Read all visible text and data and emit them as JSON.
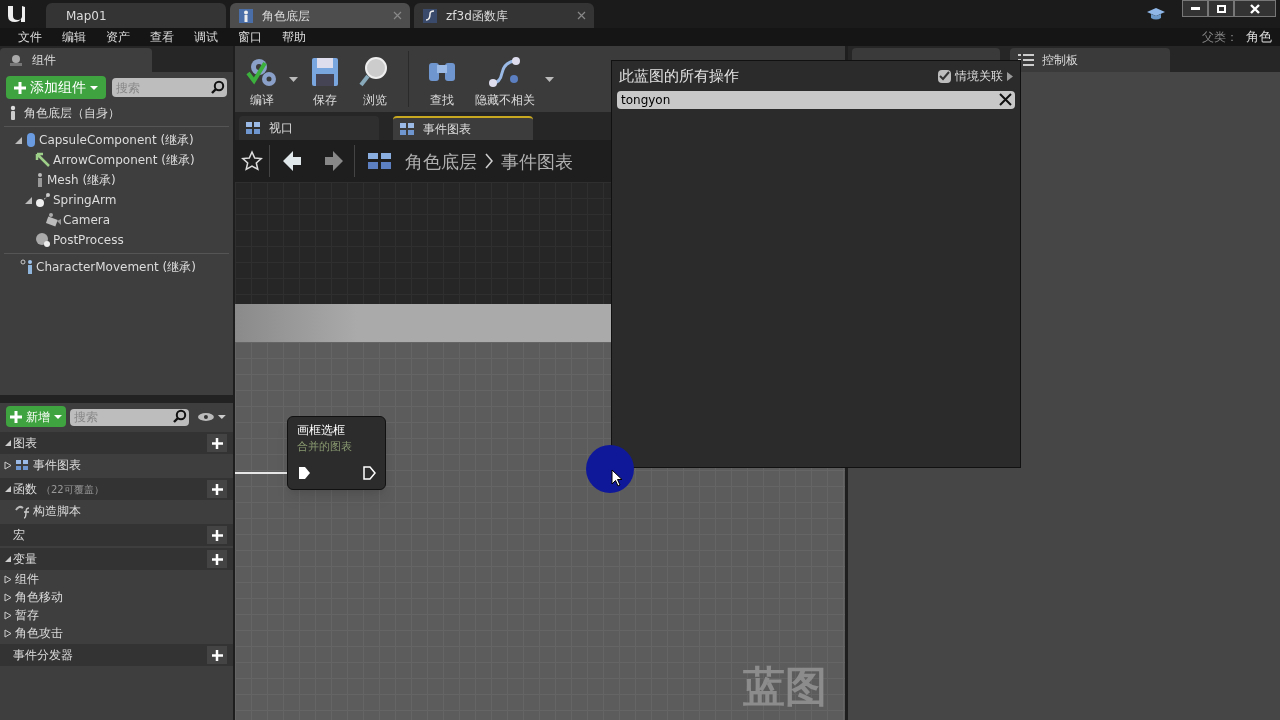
{
  "title_tabs": [
    {
      "label": "Map01",
      "kind": "level",
      "selected": false
    },
    {
      "label": "角色底层",
      "kind": "blueprint",
      "selected": true
    },
    {
      "label": "zf3d函数库",
      "kind": "library",
      "selected": false
    }
  ],
  "menu": [
    "文件",
    "编辑",
    "资产",
    "查看",
    "调试",
    "窗口",
    "帮助"
  ],
  "parent_class": {
    "label": "父类：",
    "value": "角色"
  },
  "components_panel": {
    "title": "组件",
    "add_button": "添加组件",
    "search": {
      "placeholder": "搜索"
    },
    "root": {
      "label": "角色底层（自身）",
      "kind": "actor"
    },
    "tree": [
      {
        "label": "CapsuleComponent (继承)",
        "kind": "capsule",
        "expanded": true,
        "children": [
          {
            "label": "ArrowComponent (继承)",
            "kind": "arrow"
          },
          {
            "label": "Mesh (继承)",
            "kind": "mesh"
          },
          {
            "label": "SpringArm",
            "kind": "spring",
            "expanded": true,
            "children": [
              {
                "label": "Camera",
                "kind": "camera"
              }
            ]
          },
          {
            "label": "PostProcess",
            "kind": "post"
          }
        ]
      }
    ],
    "movement": {
      "label": "CharacterMovement (继承)",
      "kind": "movement"
    }
  },
  "toolbar": [
    {
      "label": "编译",
      "kind": "compile",
      "dropdown": true
    },
    {
      "label": "保存",
      "kind": "save",
      "dropdown": false
    },
    {
      "label": "浏览",
      "kind": "browse",
      "dropdown": false
    },
    {
      "label": "查找",
      "kind": "find",
      "dropdown": false
    },
    {
      "label": "隐藏不相关",
      "kind": "hide",
      "dropdown": true
    }
  ],
  "editor_tabs": [
    {
      "label": "视口",
      "selected": false
    },
    {
      "label": "事件图表",
      "selected": true
    }
  ],
  "breadcrumb": [
    "角色底层",
    "事件图表"
  ],
  "graph": {
    "node": {
      "title": "画框选框",
      "subtitle": "合并的图表"
    },
    "watermark": "蓝图"
  },
  "popup": {
    "title": "此蓝图的所有操作",
    "context_toggle": {
      "label": "情境关联",
      "checked": true
    },
    "search": {
      "value": "tongyon"
    }
  },
  "right_tabs": [
    {
      "label": "控制板"
    }
  ],
  "my_blueprint": {
    "new_button": "新增",
    "search": {
      "placeholder": "搜索"
    },
    "sections": [
      {
        "label": "图表",
        "kind": "list",
        "expanded": true,
        "items": [
          {
            "label": "事件图表",
            "kind": "graph",
            "expanded": false
          }
        ]
      },
      {
        "label": "函数",
        "note": "（22可覆盖）",
        "kind": "list",
        "expanded": true,
        "items": [
          {
            "label": "构造脚本",
            "kind": "function"
          }
        ]
      },
      {
        "label": "宏",
        "kind": "empty"
      },
      {
        "label": "变量",
        "kind": "list",
        "expanded": true,
        "items": [
          {
            "label": "组件",
            "kind": "category",
            "expanded": false
          },
          {
            "label": "角色移动",
            "kind": "category",
            "expanded": false
          },
          {
            "label": "暂存",
            "kind": "category",
            "expanded": false
          },
          {
            "label": "角色攻击",
            "kind": "category",
            "expanded": false
          }
        ]
      },
      {
        "label": "事件分发器",
        "kind": "empty"
      }
    ]
  }
}
